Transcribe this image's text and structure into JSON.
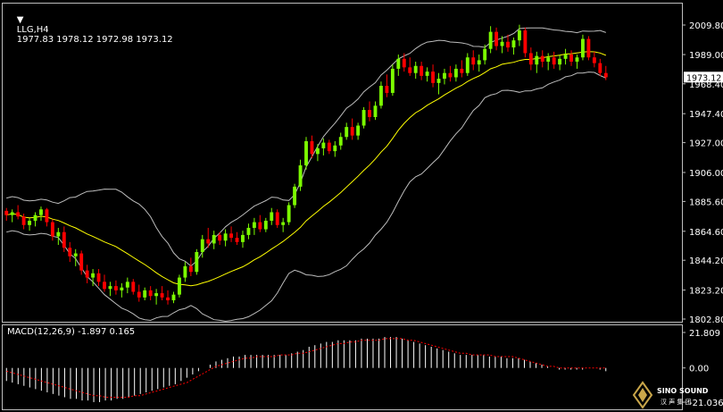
{
  "header": {
    "symbol": "LLG,H4",
    "ohlc": "1977.83 1978.12 1972.98 1973.12"
  },
  "price_badge": "1973.12",
  "macd_header": "MACD(12,26,9) -1.897 0.165",
  "logo": {
    "name": "SINO SOUND"
  },
  "colors": {
    "background": "#000000",
    "bull": "#7cfc00",
    "bear": "#ff0000",
    "band": "#bdbdbd",
    "ma": "#ffff00",
    "macd_hist": "#ffffff",
    "macd_signal": "#ff0000",
    "axis_text": "#ffffff"
  },
  "chart_data": [
    {
      "type": "candlestick",
      "title": "LLG,H4",
      "ylim": [
        1802.8,
        2009.8
      ],
      "yticks": [
        "2009.80",
        "1989.00",
        "1968.40",
        "1947.40",
        "1927.00",
        "1906.00",
        "1885.60",
        "1864.60",
        "1844.20",
        "1823.20",
        "1802.80"
      ],
      "current_price": 1973.12,
      "indicators": [
        "Bollinger Bands (upper, lower)",
        "Moving average (middle)"
      ],
      "candles": [
        [
          1879,
          1881,
          1872,
          1876
        ],
        [
          1876,
          1880,
          1871,
          1878
        ],
        [
          1878,
          1883,
          1873,
          1875
        ],
        [
          1875,
          1877,
          1866,
          1869
        ],
        [
          1869,
          1874,
          1865,
          1872
        ],
        [
          1872,
          1878,
          1868,
          1876
        ],
        [
          1876,
          1882,
          1872,
          1880
        ],
        [
          1880,
          1881,
          1868,
          1871
        ],
        [
          1871,
          1873,
          1858,
          1861
        ],
        [
          1861,
          1867,
          1855,
          1864
        ],
        [
          1864,
          1868,
          1850,
          1853
        ],
        [
          1853,
          1857,
          1843,
          1847
        ],
        [
          1847,
          1852,
          1840,
          1849
        ],
        [
          1849,
          1851,
          1834,
          1837
        ],
        [
          1837,
          1841,
          1828,
          1832
        ],
        [
          1832,
          1838,
          1826,
          1835
        ],
        [
          1835,
          1838,
          1826,
          1829
        ],
        [
          1829,
          1834,
          1822,
          1824
        ],
        [
          1824,
          1829,
          1819,
          1826
        ],
        [
          1826,
          1830,
          1820,
          1823
        ],
        [
          1823,
          1828,
          1818,
          1825
        ],
        [
          1825,
          1832,
          1821,
          1829
        ],
        [
          1829,
          1831,
          1820,
          1822
        ],
        [
          1822,
          1827,
          1815,
          1818
        ],
        [
          1818,
          1825,
          1816,
          1823
        ],
        [
          1823,
          1826,
          1816,
          1819
        ],
        [
          1819,
          1824,
          1813,
          1821
        ],
        [
          1821,
          1826,
          1816,
          1818
        ],
        [
          1818,
          1823,
          1813,
          1816
        ],
        [
          1816,
          1822,
          1814,
          1820
        ],
        [
          1820,
          1834,
          1818,
          1832
        ],
        [
          1832,
          1843,
          1829,
          1840
        ],
        [
          1840,
          1846,
          1833,
          1836
        ],
        [
          1836,
          1852,
          1834,
          1850
        ],
        [
          1850,
          1862,
          1846,
          1859
        ],
        [
          1859,
          1867,
          1853,
          1856
        ],
        [
          1856,
          1865,
          1852,
          1862
        ],
        [
          1862,
          1864,
          1855,
          1858
        ],
        [
          1858,
          1866,
          1854,
          1863
        ],
        [
          1863,
          1868,
          1857,
          1860
        ],
        [
          1860,
          1864,
          1855,
          1857
        ],
        [
          1857,
          1865,
          1853,
          1862
        ],
        [
          1862,
          1870,
          1859,
          1867
        ],
        [
          1867,
          1874,
          1862,
          1871
        ],
        [
          1871,
          1876,
          1864,
          1866
        ],
        [
          1866,
          1874,
          1864,
          1872
        ],
        [
          1872,
          1881,
          1869,
          1878
        ],
        [
          1878,
          1880,
          1867,
          1869
        ],
        [
          1869,
          1874,
          1864,
          1871
        ],
        [
          1871,
          1885,
          1869,
          1883
        ],
        [
          1883,
          1898,
          1881,
          1896
        ],
        [
          1896,
          1915,
          1893,
          1911
        ],
        [
          1911,
          1931,
          1908,
          1928
        ],
        [
          1928,
          1932,
          1916,
          1919
        ],
        [
          1919,
          1926,
          1914,
          1923
        ],
        [
          1923,
          1930,
          1918,
          1927
        ],
        [
          1927,
          1929,
          1919,
          1921
        ],
        [
          1921,
          1928,
          1917,
          1925
        ],
        [
          1925,
          1934,
          1922,
          1931
        ],
        [
          1931,
          1941,
          1929,
          1938
        ],
        [
          1938,
          1944,
          1929,
          1932
        ],
        [
          1932,
          1941,
          1929,
          1939
        ],
        [
          1939,
          1952,
          1937,
          1950
        ],
        [
          1950,
          1956,
          1942,
          1945
        ],
        [
          1945,
          1956,
          1943,
          1953
        ],
        [
          1953,
          1970,
          1951,
          1967
        ],
        [
          1967,
          1975,
          1959,
          1962
        ],
        [
          1962,
          1982,
          1960,
          1979
        ],
        [
          1979,
          1989,
          1974,
          1986
        ],
        [
          1986,
          1990,
          1977,
          1980
        ],
        [
          1980,
          1987,
          1974,
          1976
        ],
        [
          1976,
          1984,
          1972,
          1981
        ],
        [
          1981,
          1984,
          1971,
          1974
        ],
        [
          1974,
          1980,
          1970,
          1977
        ],
        [
          1977,
          1982,
          1966,
          1969
        ],
        [
          1969,
          1976,
          1961,
          1972
        ],
        [
          1972,
          1979,
          1968,
          1976
        ],
        [
          1976,
          1981,
          1970,
          1973
        ],
        [
          1973,
          1982,
          1970,
          1979
        ],
        [
          1979,
          1985,
          1973,
          1976
        ],
        [
          1976,
          1990,
          1974,
          1987
        ],
        [
          1987,
          1992,
          1978,
          1982
        ],
        [
          1982,
          1989,
          1977,
          1985
        ],
        [
          1985,
          1996,
          1982,
          1993
        ],
        [
          1993,
          2009,
          1990,
          2005
        ],
        [
          2005,
          2008,
          1992,
          1995
        ],
        [
          1995,
          2002,
          1990,
          1998
        ],
        [
          1998,
          2003,
          1991,
          1994
        ],
        [
          1994,
          2001,
          1989,
          1999
        ],
        [
          1999,
          2010,
          1995,
          2006
        ],
        [
          2006,
          2008,
          1987,
          1990
        ],
        [
          1990,
          1994,
          1978,
          1982
        ],
        [
          1982,
          1991,
          1976,
          1988
        ],
        [
          1988,
          1992,
          1980,
          1984
        ],
        [
          1984,
          1990,
          1978,
          1987
        ],
        [
          1987,
          1991,
          1979,
          1982
        ],
        [
          1982,
          1989,
          1978,
          1986
        ],
        [
          1986,
          1993,
          1982,
          1989
        ],
        [
          1989,
          1992,
          1981,
          1984
        ],
        [
          1984,
          1989,
          1979,
          1987
        ],
        [
          1987,
          2003,
          1985,
          2000
        ],
        [
          2000,
          2002,
          1985,
          1987
        ],
        [
          1987,
          1991,
          1980,
          1983
        ],
        [
          1983,
          1986,
          1974,
          1976
        ],
        [
          1976,
          1981,
          1971,
          1973
        ]
      ]
    },
    {
      "type": "macd",
      "title": "MACD(12,26,9)",
      "main": -1.897,
      "signal": 0.165,
      "ylim": [
        -21.036,
        21.809
      ],
      "yticks": [
        "21.809",
        "0.00",
        "-21.036"
      ],
      "histogram": [
        -8,
        -9,
        -10,
        -11,
        -12,
        -13,
        -14,
        -15,
        -16,
        -17,
        -18,
        -19,
        -19,
        -20,
        -20,
        -21,
        -21,
        -20,
        -20,
        -19,
        -19,
        -18,
        -17,
        -16,
        -15,
        -14,
        -13,
        -12,
        -11,
        -10,
        -8,
        -6,
        -4,
        -2,
        0,
        2,
        4,
        5,
        6,
        7,
        7,
        8,
        8,
        8,
        8,
        8,
        8,
        8,
        8,
        9,
        10,
        11,
        13,
        14,
        15,
        16,
        16,
        17,
        17,
        17,
        17,
        18,
        18,
        18,
        18,
        19,
        19,
        19,
        18,
        17,
        16,
        15,
        14,
        13,
        12,
        11,
        10,
        9,
        8,
        8,
        8,
        8,
        8,
        7,
        7,
        7,
        6,
        6,
        6,
        5,
        4,
        3,
        2,
        1,
        0,
        -1,
        -1,
        -1,
        -1,
        -1,
        0,
        0,
        -1,
        -2
      ],
      "signal_line": [
        -2,
        -3,
        -4,
        -5,
        -6,
        -7,
        -8,
        -9,
        -10,
        -11,
        -12,
        -13,
        -14,
        -15,
        -16,
        -17,
        -17,
        -18,
        -18,
        -18,
        -18,
        -18,
        -17,
        -17,
        -16,
        -15,
        -14,
        -13,
        -12,
        -11,
        -10,
        -9,
        -7,
        -5,
        -3,
        -1,
        1,
        2,
        3,
        4,
        5,
        6,
        6,
        7,
        7,
        7,
        7,
        8,
        8,
        8,
        9,
        9,
        10,
        11,
        12,
        13,
        14,
        15,
        15,
        16,
        16,
        17,
        17,
        17,
        17,
        18,
        18,
        18,
        18,
        17,
        17,
        16,
        15,
        14,
        13,
        12,
        11,
        10,
        9,
        9,
        8,
        8,
        8,
        8,
        7,
        7,
        7,
        7,
        6,
        5,
        4,
        3,
        2,
        1,
        1,
        0,
        0,
        0,
        0,
        0,
        0,
        0,
        0,
        0
      ]
    }
  ]
}
